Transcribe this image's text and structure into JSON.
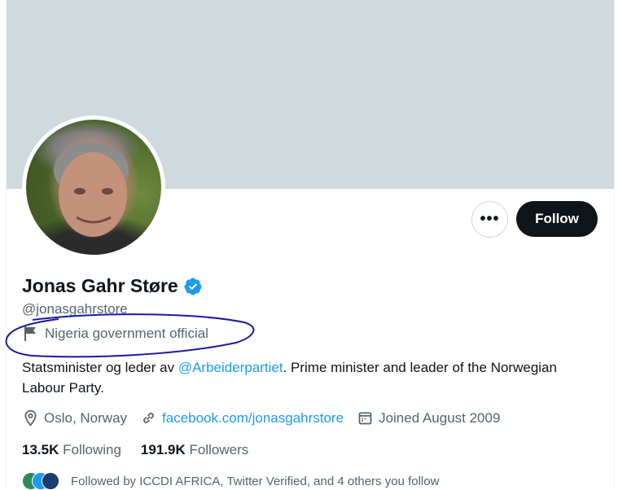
{
  "profile": {
    "display_name": "Jonas Gahr Støre",
    "handle": "@jonasgahrstore",
    "affiliation_label": "Nigeria government official",
    "bio_prefix": "Statsminister og leder av ",
    "bio_mention": "@Arbeiderpartiet",
    "bio_suffix": ". Prime minister and leader of the Norwegian Labour Party.",
    "location": "Oslo, Norway",
    "website": "facebook.com/jonasgahrstore",
    "joined": "Joined August 2009"
  },
  "actions": {
    "more_label": "•••",
    "follow_label": "Follow"
  },
  "stats": {
    "following_count": "13.5K",
    "following_label": "Following",
    "followers_count": "191.9K",
    "followers_label": "Followers"
  },
  "followed_by": "Followed by ICCDI AFRICA, Twitter Verified, and 4 others you follow",
  "colors": {
    "banner": "#cfd9de",
    "accent": "#1d9bf0",
    "annotation": "#1a1a9e",
    "follow_button": "#0f1419"
  },
  "icons": {
    "verified": "verified-badge-icon",
    "flag": "flag-icon",
    "location": "location-pin-icon",
    "link": "link-icon",
    "calendar": "calendar-icon"
  }
}
